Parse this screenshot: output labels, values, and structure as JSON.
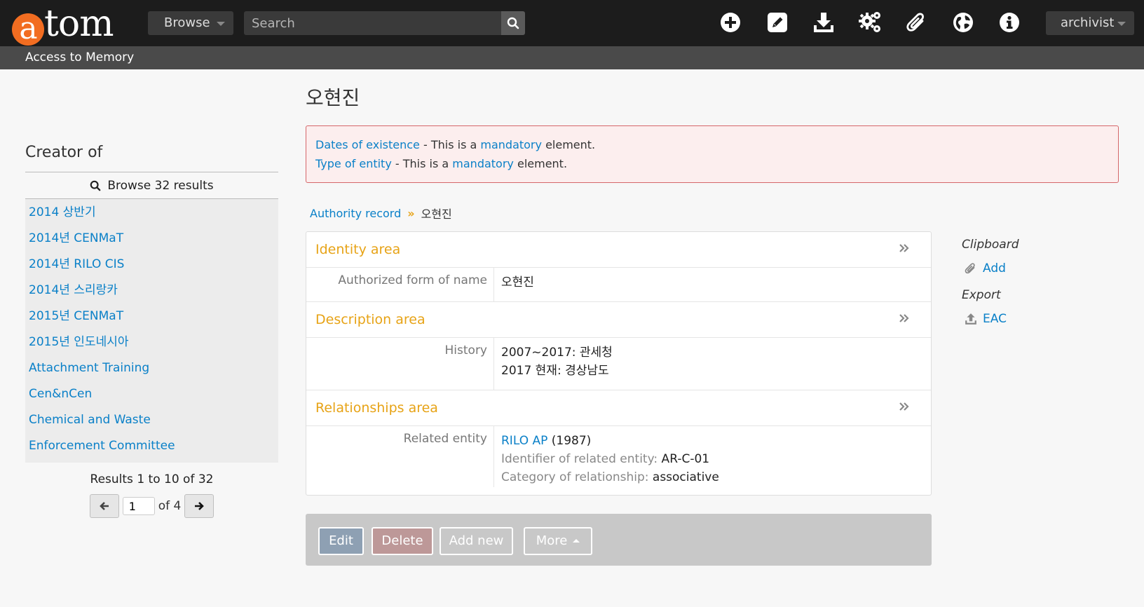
{
  "header": {
    "logo_letter": "a",
    "logo_rest": "tom",
    "browse_label": "Browse",
    "search_placeholder": "Search",
    "user_label": "archivist",
    "subtitle": "Access to Memory",
    "icons": [
      "plus-circle-icon",
      "pencil-edit-icon",
      "download-import-icon",
      "gears-admin-icon",
      "paperclip-clipboard-icon",
      "globe-language-icon",
      "info-icon"
    ]
  },
  "sidebar": {
    "title": "Creator of",
    "browse_label": "Browse 32 results",
    "items": [
      "2014 상반기",
      "2014년 CENMaT",
      "2014년 RILO CIS",
      "2014년 스리랑카",
      "2015년 CENMaT",
      "2015년 인도네시아",
      "Attachment Training",
      "Cen&nCen",
      "Chemical and Waste",
      "Enforcement Committee"
    ],
    "results_text": "Results 1 to 10 of 32",
    "page_value": "1",
    "page_of": "of 4"
  },
  "main": {
    "title": "오현진",
    "errors": [
      {
        "field": "Dates of existence",
        "mid": " - This is a ",
        "link": "mandatory",
        "end": " element."
      },
      {
        "field": "Type of entity",
        "mid": " - This is a ",
        "link": "mandatory",
        "end": " element."
      }
    ],
    "breadcrumb": {
      "parent": "Authority record",
      "sep": "»",
      "current": "오현진"
    },
    "areas": {
      "identity": {
        "title": "Identity area",
        "label": "Authorized form of name",
        "value": "오현진"
      },
      "description": {
        "title": "Description area",
        "label": "History",
        "line1": "2007~2017: 관세청",
        "line2": "2017 현재: 경상남도"
      },
      "relationships": {
        "title": "Relationships area",
        "label": "Related entity",
        "entity_link": "RILO AP",
        "entity_date": " (1987)",
        "identifier_label": "Identifier of related entity:",
        "identifier_value": " AR-C-01",
        "category_label": "Category of relationship:",
        "category_value": " associative"
      }
    },
    "chevron": "»"
  },
  "context": {
    "clipboard_title": "Clipboard",
    "clipboard_add": "Add",
    "export_title": "Export",
    "export_eac": "EAC"
  },
  "actions": {
    "edit": "Edit",
    "delete": "Delete",
    "add_new": "Add new",
    "more": "More"
  },
  "colors": {
    "accent_orange": "#f26d21",
    "area_title": "#e7a316",
    "link": "#0a80c8",
    "error_bg": "#fceeee",
    "error_border": "#d5676a"
  }
}
